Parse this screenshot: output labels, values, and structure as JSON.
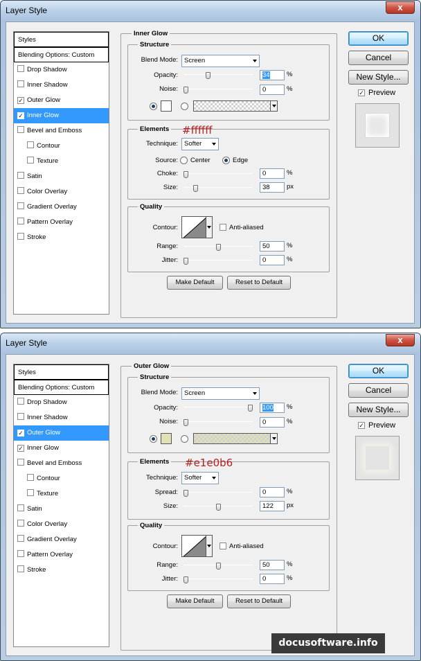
{
  "dialogs": [
    {
      "title": "Layer Style",
      "close_label": "x",
      "styles_list": [
        {
          "label": "Styles",
          "kind": "header",
          "checked": false,
          "selected": false
        },
        {
          "label": "Blending Options: Custom",
          "kind": "header",
          "checked": false,
          "selected": false
        },
        {
          "label": "Drop Shadow",
          "kind": "item",
          "checked": false,
          "selected": false
        },
        {
          "label": "Inner Shadow",
          "kind": "item",
          "checked": false,
          "selected": false
        },
        {
          "label": "Outer Glow",
          "kind": "item",
          "checked": true,
          "selected": false
        },
        {
          "label": "Inner Glow",
          "kind": "item",
          "checked": true,
          "selected": true
        },
        {
          "label": "Bevel and Emboss",
          "kind": "item",
          "checked": false,
          "selected": false
        },
        {
          "label": "Contour",
          "kind": "sub",
          "checked": false,
          "selected": false
        },
        {
          "label": "Texture",
          "kind": "sub",
          "checked": false,
          "selected": false
        },
        {
          "label": "Satin",
          "kind": "item",
          "checked": false,
          "selected": false
        },
        {
          "label": "Color Overlay",
          "kind": "item",
          "checked": false,
          "selected": false
        },
        {
          "label": "Gradient Overlay",
          "kind": "item",
          "checked": false,
          "selected": false
        },
        {
          "label": "Pattern Overlay",
          "kind": "item",
          "checked": false,
          "selected": false
        },
        {
          "label": "Stroke",
          "kind": "item",
          "checked": false,
          "selected": false
        }
      ],
      "panel_title": "Inner Glow",
      "structure": {
        "legend": "Structure",
        "blend_mode_label": "Blend Mode:",
        "blend_mode": "Screen",
        "opacity_label": "Opacity:",
        "opacity": "34",
        "opacity_level": 0.34,
        "noise_label": "Noise:",
        "noise": "0",
        "noise_level": 0,
        "percent": "%",
        "glow_color": "#ffffff",
        "color_radio_selected": true
      },
      "annotation": "#ffffff",
      "elements": {
        "legend": "Elements",
        "technique_label": "Technique:",
        "technique": "Softer",
        "source_label": "Source:",
        "source_center": "Center",
        "source_edge": "Edge",
        "first_label": "Choke:",
        "first_value": "0",
        "first_unit": "%",
        "first_level": 0,
        "size_label": "Size:",
        "size": "38",
        "size_level": 0.15,
        "size_unit": "px"
      },
      "quality": {
        "legend": "Quality",
        "contour_label": "Contour:",
        "anti_aliased": "Anti-aliased",
        "range_label": "Range:",
        "range": "50",
        "range_level": 0.5,
        "jitter_label": "Jitter:",
        "jitter": "0",
        "jitter_level": 0,
        "percent": "%"
      },
      "make_default": "Make Default",
      "reset_default": "Reset to Default",
      "ok": "OK",
      "cancel": "Cancel",
      "new_style": "New Style...",
      "preview_label": "Preview",
      "preview_checked": true
    },
    {
      "title": "Layer Style",
      "close_label": "x",
      "styles_list": [
        {
          "label": "Styles",
          "kind": "header",
          "checked": false,
          "selected": false
        },
        {
          "label": "Blending Options: Custom",
          "kind": "header",
          "checked": false,
          "selected": false
        },
        {
          "label": "Drop Shadow",
          "kind": "item",
          "checked": false,
          "selected": false
        },
        {
          "label": "Inner Shadow",
          "kind": "item",
          "checked": false,
          "selected": false
        },
        {
          "label": "Outer Glow",
          "kind": "item",
          "checked": true,
          "selected": true
        },
        {
          "label": "Inner Glow",
          "kind": "item",
          "checked": true,
          "selected": false
        },
        {
          "label": "Bevel and Emboss",
          "kind": "item",
          "checked": false,
          "selected": false
        },
        {
          "label": "Contour",
          "kind": "sub",
          "checked": false,
          "selected": false
        },
        {
          "label": "Texture",
          "kind": "sub",
          "checked": false,
          "selected": false
        },
        {
          "label": "Satin",
          "kind": "item",
          "checked": false,
          "selected": false
        },
        {
          "label": "Color Overlay",
          "kind": "item",
          "checked": false,
          "selected": false
        },
        {
          "label": "Gradient Overlay",
          "kind": "item",
          "checked": false,
          "selected": false
        },
        {
          "label": "Pattern Overlay",
          "kind": "item",
          "checked": false,
          "selected": false
        },
        {
          "label": "Stroke",
          "kind": "item",
          "checked": false,
          "selected": false
        }
      ],
      "panel_title": "Outer Glow",
      "structure": {
        "legend": "Structure",
        "blend_mode_label": "Blend Mode:",
        "blend_mode": "Screen",
        "opacity_label": "Opacity:",
        "opacity": "100",
        "opacity_level": 1,
        "noise_label": "Noise:",
        "noise": "0",
        "noise_level": 0,
        "percent": "%",
        "glow_color": "#e1e0b6",
        "color_radio_selected": true
      },
      "annotation": "#e1e0b6",
      "elements": {
        "legend": "Elements",
        "technique_label": "Technique:",
        "technique": "Softer",
        "first_label": "Spread:",
        "first_value": "0",
        "first_unit": "%",
        "first_level": 0,
        "size_label": "Size:",
        "size": "122",
        "size_level": 0.5,
        "size_unit": "px"
      },
      "quality": {
        "legend": "Quality",
        "contour_label": "Contour:",
        "anti_aliased": "Anti-aliased",
        "range_label": "Range:",
        "range": "50",
        "range_level": 0.5,
        "jitter_label": "Jitter:",
        "jitter": "0",
        "jitter_level": 0,
        "percent": "%"
      },
      "make_default": "Make Default",
      "reset_default": "Reset to Default",
      "ok": "OK",
      "cancel": "Cancel",
      "new_style": "New Style...",
      "preview_label": "Preview",
      "preview_checked": true
    }
  ],
  "watermark": "docusoftware.info",
  "colors": {
    "selection": "#3399ff",
    "annotation": "#b32020"
  }
}
